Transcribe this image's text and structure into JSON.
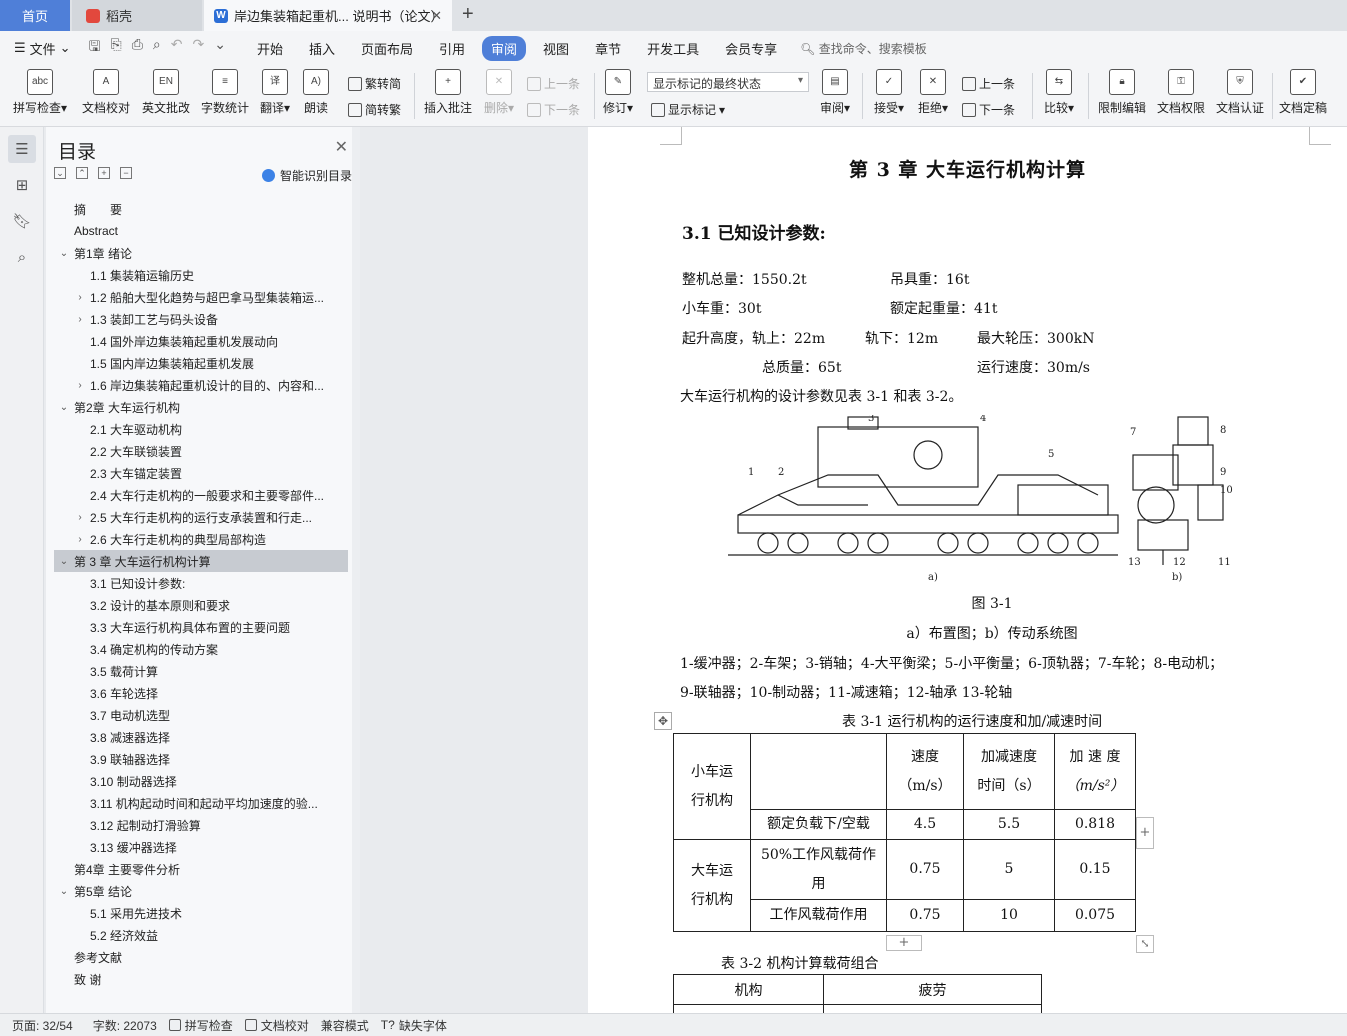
{
  "tabs": {
    "home": "首页",
    "daoke": "稻壳",
    "doc": "岸边集装箱起重机... 说明书（论文）"
  },
  "menu": {
    "file": "文件",
    "items": [
      "开始",
      "插入",
      "页面布局",
      "引用",
      "审阅",
      "视图",
      "章节",
      "开发工具",
      "会员专享"
    ],
    "active": "审阅",
    "search": "查找命令、搜索模板"
  },
  "ribbon": {
    "spell": "拼写检查",
    "doc_check": "文档校对",
    "english": "英文批改",
    "word_count": "字数统计",
    "translate": "翻译",
    "read_aloud": "朗读",
    "trad_simp": "繁转简",
    "simp_trad": "简转繁",
    "insert_comment": "插入批注",
    "delete": "删除",
    "prev": "上一条",
    "next": "下一条",
    "revise": "修订",
    "markup_state": "显示标记的最终状态",
    "show_markup": "显示标记",
    "review": "审阅",
    "accept": "接受",
    "reject": "拒绝",
    "prev2": "上一条",
    "next2": "下一条",
    "compare": "比较",
    "restrict": "限制编辑",
    "permission": "文档权限",
    "certify": "文档认证",
    "finalize": "文档定稿",
    "abc_icon": "abc"
  },
  "toc": {
    "title": "目录",
    "smart": "智能识别目录",
    "items": [
      {
        "text": "摘　　要",
        "level": 1,
        "arrow": ""
      },
      {
        "text": "Abstract",
        "level": 1,
        "arrow": ""
      },
      {
        "text": "第1章  绪论",
        "level": 1,
        "arrow": "v"
      },
      {
        "text": "1.1   集装箱运输历史",
        "level": 2,
        "arrow": ""
      },
      {
        "text": "1.2   船舶大型化趋势与超巴拿马型集装箱运...",
        "level": 2,
        "arrow": ">"
      },
      {
        "text": "1.3     装卸工艺与码头设备",
        "level": 2,
        "arrow": ">"
      },
      {
        "text": "1.4   国外岸边集装箱起重机发展动向",
        "level": 2,
        "arrow": ""
      },
      {
        "text": "1.5   国内岸边集装箱起重机发展",
        "level": 2,
        "arrow": ""
      },
      {
        "text": "1.6   岸边集装箱起重机设计的目的、内容和...",
        "level": 2,
        "arrow": ">"
      },
      {
        "text": "第2章  大车运行机构",
        "level": 1,
        "arrow": "v"
      },
      {
        "text": "2.1    大车驱动机构",
        "level": 2,
        "arrow": ""
      },
      {
        "text": "2.2  大车联锁装置",
        "level": 2,
        "arrow": ""
      },
      {
        "text": "2.3      大车锚定装置",
        "level": 2,
        "arrow": ""
      },
      {
        "text": "2.4  大车行走机构的一般要求和主要零部件...",
        "level": 2,
        "arrow": ""
      },
      {
        "text": "2.5      大车行走机构的运行支承装置和行走...",
        "level": 2,
        "arrow": ">"
      },
      {
        "text": "2.6  大车行走机构的典型局部构造",
        "level": 2,
        "arrow": ">"
      },
      {
        "text": "第 3 章     大车运行机构计算",
        "level": 1,
        "arrow": "v",
        "active": true
      },
      {
        "text": "3.1    已知设计参数:",
        "level": 2,
        "arrow": ""
      },
      {
        "text": "3.2   设计的基本原则和要求",
        "level": 2,
        "arrow": ""
      },
      {
        "text": "3.3      大车运行机构具体布置的主要问题",
        "level": 2,
        "arrow": ""
      },
      {
        "text": "3.4     确定机构的传动方案",
        "level": 2,
        "arrow": ""
      },
      {
        "text": "3.5    载荷计算",
        "level": 2,
        "arrow": ""
      },
      {
        "text": "3.6    车轮选择",
        "level": 2,
        "arrow": ""
      },
      {
        "text": "3.7    电动机选型",
        "level": 2,
        "arrow": ""
      },
      {
        "text": "3.8  减速器选择",
        "level": 2,
        "arrow": ""
      },
      {
        "text": "3.9    联轴器选择",
        "level": 2,
        "arrow": ""
      },
      {
        "text": "3.10    制动器选择",
        "level": 2,
        "arrow": ""
      },
      {
        "text": "3.11    机构起动时间和起动平均加速度的验...",
        "level": 2,
        "arrow": ""
      },
      {
        "text": "3.12    起制动打滑验算",
        "level": 2,
        "arrow": ""
      },
      {
        "text": "3.13     缓冲器选择",
        "level": 2,
        "arrow": ""
      },
      {
        "text": "第4章  主要零件分析",
        "level": 1,
        "arrow": ""
      },
      {
        "text": "第5章  结论",
        "level": 1,
        "arrow": "v"
      },
      {
        "text": "5.1  采用先进技术",
        "level": 2,
        "arrow": ""
      },
      {
        "text": "5.2  经济效益",
        "level": 2,
        "arrow": ""
      },
      {
        "text": "参考文献",
        "level": 1,
        "arrow": ""
      },
      {
        "text": "致  谢",
        "level": 1,
        "arrow": ""
      }
    ]
  },
  "doc": {
    "chapter_title": "第 3 章      大车运行机构计算",
    "section_title": "3.1   已知设计参数:",
    "params": {
      "total_mass": "整机总量：1550.2t",
      "spreader": "吊具重：16t",
      "trolley": "小车重：30t",
      "rated_load": "额定起重量：41t",
      "lift_height": "起升高度，轨上：22m",
      "below_rail": "轨下：12m",
      "max_wheel": "最大轮压：300kN",
      "total_mass2": "总质量：65t",
      "speed": "运行速度：30m/s"
    },
    "intro": "大车运行机构的设计参数见表 3-1 和表 3-2。",
    "figure_label_a": "a)",
    "figure_label_b": "b)",
    "figure_caption": "图 3-1",
    "figure_sub": "a）布置图；b）传动系统图",
    "legend1": "1-缓冲器；2-车架；3-销轴；4-大平衡梁；5-小平衡量；6-顶轨器；7-车轮；8-电动机；",
    "legend2": "9-联轴器；10-制动器；11-减速箱；12-轴承 13-轮轴",
    "table1_caption": "表 3-1 运行机构的运行速度和加/减速时间",
    "table1": {
      "h_speed": "速度",
      "h_speed_unit": "（m/s）",
      "h_time": "加减速度",
      "h_time_unit": "时间（s）",
      "h_acc": "加 速 度",
      "h_acc_unit": "（m/s²）",
      "trolley_mech1": "小车运",
      "trolley_mech2": "行机构",
      "r1_cond": "额定负载下/空载",
      "r1_v": "4.5",
      "r1_t": "5.5",
      "r1_a": "0.818",
      "gantry_mech1": "大车运",
      "gantry_mech2": "行机构",
      "r2_cond1": "50%工作风载荷作",
      "r2_cond2": "用",
      "r2_v": "0.75",
      "r2_t": "5",
      "r2_a": "0.15",
      "r3_cond": "工作风载荷作用",
      "r3_v": "0.75",
      "r3_t": "10",
      "r3_a": "0.075"
    },
    "table2_caption": "表 3-2 机构计算载荷组合",
    "table2": {
      "h_mech": "机构",
      "h_fatigue": "疲劳"
    }
  },
  "status": {
    "page": "页面: 32/54",
    "words": "字数: 22073",
    "spell": "拼写检查",
    "proof": "文档校对",
    "compat": "兼容模式",
    "missing_font": "缺失字体"
  }
}
